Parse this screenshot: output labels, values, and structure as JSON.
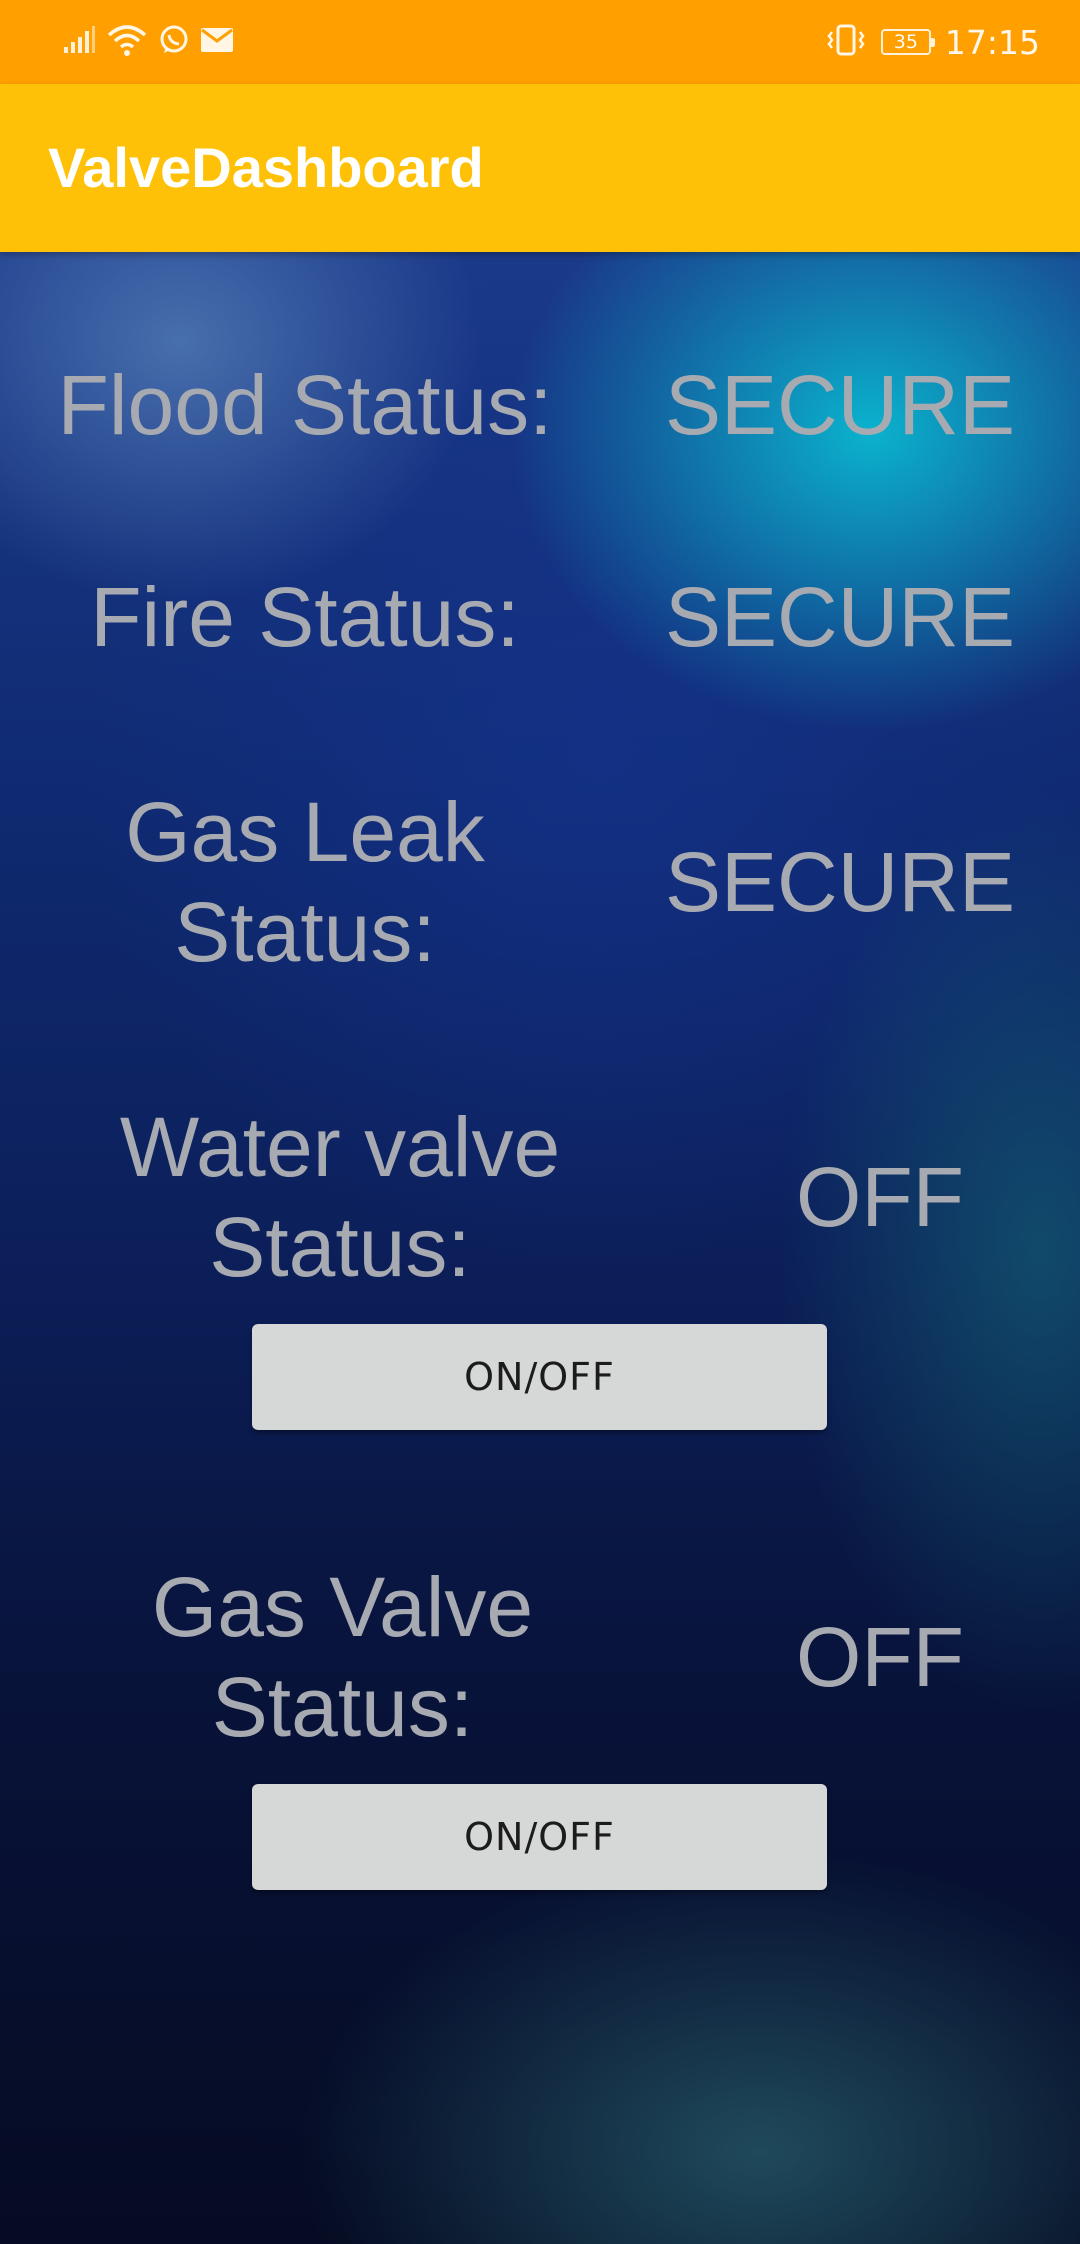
{
  "status_bar": {
    "time": "17:15",
    "battery": "35",
    "icons": [
      "signal-icon",
      "wifi-icon",
      "whatsapp-icon",
      "mail-icon",
      "vibrate-icon",
      "battery-icon"
    ]
  },
  "app_bar": {
    "title": "ValveDashboard"
  },
  "rows": {
    "flood": {
      "label": "Flood Status:",
      "value": "SECURE"
    },
    "fire": {
      "label": "Fire Status:",
      "value": "SECURE"
    },
    "gas_leak": {
      "label_line1": "Gas Leak",
      "label_line2": "Status:",
      "value": "SECURE"
    },
    "water_valve": {
      "label_line1": "Water valve",
      "label_line2": "Status:",
      "value": "OFF",
      "button_label": "ON/OFF"
    },
    "gas_valve": {
      "label_line1": "Gas Valve",
      "label_line2": "Status:",
      "value": "OFF",
      "button_label": "ON/OFF"
    }
  },
  "colors": {
    "status_bar_bg": "#ff9f00",
    "app_bar_bg": "#ffc107",
    "text_gray": "#a7aab0",
    "button_bg": "#d6d7d7"
  }
}
